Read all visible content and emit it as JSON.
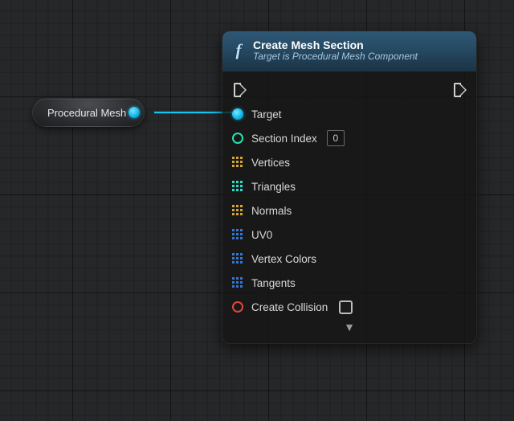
{
  "source_node": {
    "label": "Procedural Mesh",
    "output_pin": "object-out"
  },
  "node": {
    "icon": "function-icon",
    "title": "Create Mesh Section",
    "subtitle": "Target is Procedural Mesh Component",
    "exec_in": "exec-in",
    "exec_out": "exec-out",
    "pins": [
      {
        "name": "target",
        "label": "Target",
        "shape": "circle-filled",
        "color": "cyan",
        "connected": true
      },
      {
        "name": "section-index",
        "label": "Section Index",
        "shape": "circle-hollow",
        "color": "teal",
        "value": "0"
      },
      {
        "name": "vertices",
        "label": "Vertices",
        "shape": "grid3",
        "color": "gold"
      },
      {
        "name": "triangles",
        "label": "Triangles",
        "shape": "grid3",
        "color": "teal"
      },
      {
        "name": "normals",
        "label": "Normals",
        "shape": "grid3",
        "color": "gold"
      },
      {
        "name": "uv0",
        "label": "UV0",
        "shape": "grid3",
        "color": "blue"
      },
      {
        "name": "vertex-colors",
        "label": "Vertex Colors",
        "shape": "grid3",
        "color": "blue"
      },
      {
        "name": "tangents",
        "label": "Tangents",
        "shape": "grid3",
        "color": "blue"
      },
      {
        "name": "create-collision",
        "label": "Create Collision",
        "shape": "circle-hollow",
        "color": "red",
        "checkbox": true,
        "checked": false
      }
    ],
    "expand_icon": "chevron-down-icon"
  },
  "wire": {
    "color": "#16c6ef"
  }
}
